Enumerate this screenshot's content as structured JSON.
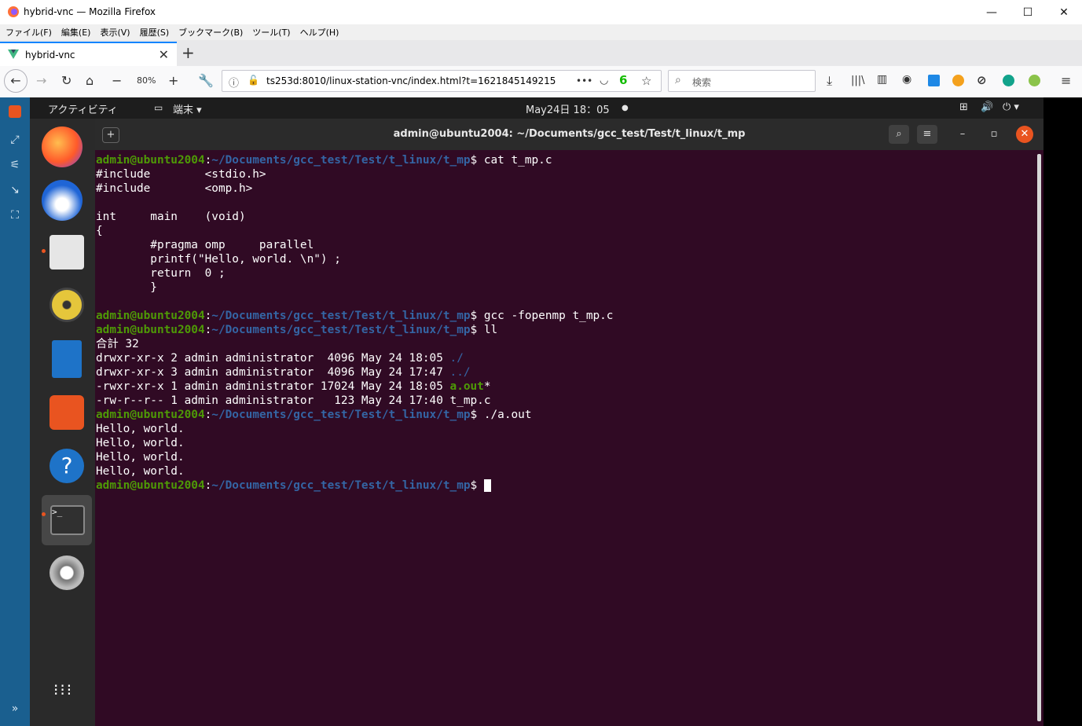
{
  "window": {
    "title": "hybrid-vnc — Mozilla Firefox",
    "minimize": "—",
    "maximize": "☐",
    "close": "✕"
  },
  "menu": [
    "ファイル(F)",
    "編集(E)",
    "表示(V)",
    "履歴(S)",
    "ブックマーク(B)",
    "ツール(T)",
    "ヘルプ(H)"
  ],
  "tab": {
    "label": "hybrid-vnc",
    "close": "✕",
    "new": "+"
  },
  "nav": {
    "zoom": "80%",
    "url": "ts253d:8010/linux-station-vnc/index.html?t=1621845149215",
    "more": "•••",
    "pocket_count": "6",
    "search_placeholder": "検索"
  },
  "ubuntu_topbar": {
    "activities": "アクティビティ",
    "app_menu": "端末 ▾",
    "clock": "May24日  18：05",
    "dot": "●"
  },
  "terminal": {
    "title": "admin@ubuntu2004: ~/Documents/gcc_test/Test/t_linux/t_mp",
    "prompt_user": "admin@ubuntu2004",
    "prompt_path": "~/Documents/gcc_test/Test/t_linux/t_mp",
    "cmd1": "cat t_mp.c",
    "code": [
      "#include        <stdio.h>",
      "#include        <omp.h>",
      "",
      "int     main    (void)",
      "{",
      "        #pragma omp     parallel",
      "        printf(\"Hello, world. \\n\") ;",
      "        return  0 ;",
      "        }",
      ""
    ],
    "cmd2": "gcc -fopenmp t_mp.c",
    "cmd3": "ll",
    "total": "合計 32",
    "ls": [
      {
        "meta": "drwxr-xr-x 2 admin administrator  4096 May 24 18:05 ",
        "name": "./",
        "suffix": ""
      },
      {
        "meta": "drwxr-xr-x 3 admin administrator  4096 May 24 17:47 ",
        "name": "../",
        "suffix": ""
      },
      {
        "meta": "-rwxr-xr-x 1 admin administrator 17024 May 24 18:05 ",
        "name": "a.out",
        "suffix": "*"
      },
      {
        "meta": "-rw-r--r-- 1 admin administrator   123 May 24 17:40 ",
        "name": "t_mp.c",
        "suffix": ""
      }
    ],
    "cmd4": "./a.out",
    "output": [
      "Hello, world.",
      "Hello, world.",
      "Hello, world.",
      "Hello, world."
    ]
  }
}
